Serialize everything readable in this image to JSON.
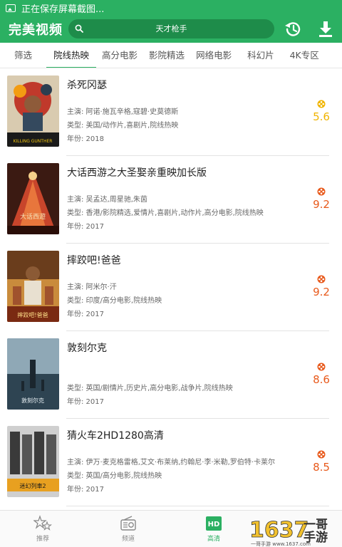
{
  "status_bar": {
    "text": "正在保存屏幕截图..."
  },
  "app_bar": {
    "title": "完美视频",
    "search_placeholder": "天才枪手",
    "search_icon": "search-icon",
    "history_icon": "history-icon",
    "download_icon": "download-icon"
  },
  "tabs": [
    {
      "label": "筛选"
    },
    {
      "label": "院线热映",
      "active": true
    },
    {
      "label": "高分电影"
    },
    {
      "label": "影院精选"
    },
    {
      "label": "网络电影"
    },
    {
      "label": "科幻片"
    },
    {
      "label": "4K专区"
    }
  ],
  "movies": [
    {
      "title": "杀死冈瑟",
      "actors": "主演: 阿诺·施瓦辛格,寇碧·史莫德斯",
      "type": "类型: 美国/动作片,喜剧片,院线热映",
      "year": "年份: 2018",
      "score": "5.6",
      "poster_text": "KILLING GUNTHER"
    },
    {
      "title": "大话西游之大圣娶亲重映加长版",
      "actors": "主演: 吴孟达,周星驰,朱茵",
      "type": "类型: 香港/影院精选,爱情片,喜剧片,动作片,高分电影,院线热映",
      "year": "年份: 2017",
      "score": "9.2",
      "poster_text": "大话西遊"
    },
    {
      "title": "摔跤吧!爸爸",
      "actors": "主演: 阿米尔·汗",
      "type": "类型: 印度/高分电影,院线热映",
      "year": "年份: 2017",
      "score": "9.2",
      "poster_text": "摔跤吧!爸爸"
    },
    {
      "title": "敦刻尔克",
      "actors": "",
      "type": "类型: 英国/剧情片,历史片,高分电影,战争片,院线热映",
      "year": "年份: 2017",
      "score": "8.6",
      "poster_text": "敦刻尔克"
    },
    {
      "title": "猜火车2HD1280高清",
      "actors": "主演: 伊万·麦克格雷格,艾文·布莱纳,约翰尼·李·米勒,罗伯特·卡莱尔",
      "type": "类型: 英国/高分电影,院线热映",
      "year": "年份: 2017",
      "score": "8.5",
      "poster_text": "迷幻列車2"
    }
  ],
  "bottom_nav": [
    {
      "label": "推荐",
      "icon": "stars-icon"
    },
    {
      "label": "频道",
      "icon": "radio-icon"
    },
    {
      "label": "高清",
      "icon": "hd-icon",
      "active": true
    }
  ],
  "watermark": {
    "brand": "1637",
    "text": "一哥手游",
    "url": "一哥手游 www.1637.com"
  },
  "colors": {
    "primary": "#2bb062",
    "score": "#e85a1c",
    "score_low": "#f0b400"
  }
}
